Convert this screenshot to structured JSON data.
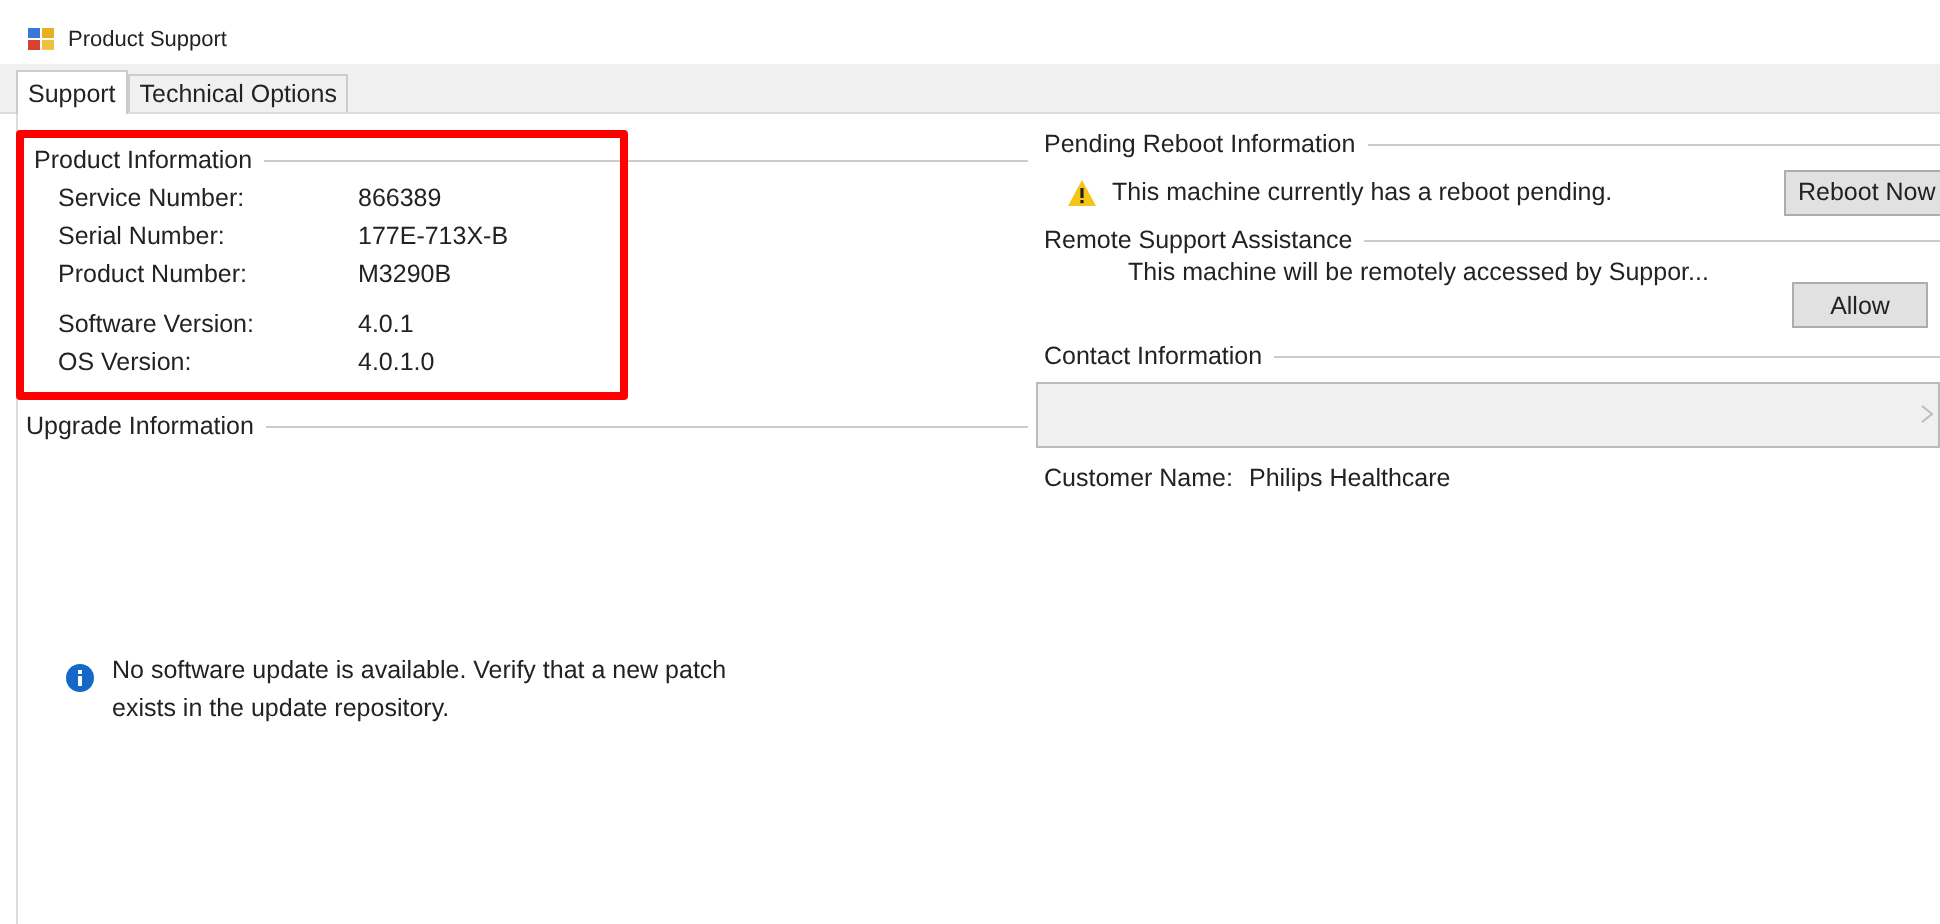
{
  "window": {
    "title": "Product Support"
  },
  "tabs": [
    {
      "label": "Support",
      "selected": true
    },
    {
      "label": "Technical Options",
      "selected": false
    }
  ],
  "product_information": {
    "title": "Product Information",
    "highlighted": true,
    "rows": [
      {
        "label": "Service Number:",
        "value": "866389"
      },
      {
        "label": "Serial Number:",
        "value": "177E-713X-B"
      },
      {
        "label": "Product Number:",
        "value": "M3290B"
      },
      {
        "label": "Software Version:",
        "value": "4.0.1"
      },
      {
        "label": "OS Version:",
        "value": "4.0.1.0"
      }
    ]
  },
  "upgrade_information": {
    "title": "Upgrade Information",
    "message": "No software update is available. Verify that a new patch exists in the update repository."
  },
  "pending_reboot": {
    "title": "Pending Reboot Information",
    "message": "This machine currently has a reboot pending.",
    "button": "Reboot Now"
  },
  "remote_support": {
    "title": "Remote Support Assistance",
    "message": "This machine will be remotely accessed by Suppor...",
    "button": "Allow"
  },
  "contact_information": {
    "title": "Contact Information",
    "customer_label": "Customer Name:",
    "customer_value": "Philips Healthcare"
  }
}
